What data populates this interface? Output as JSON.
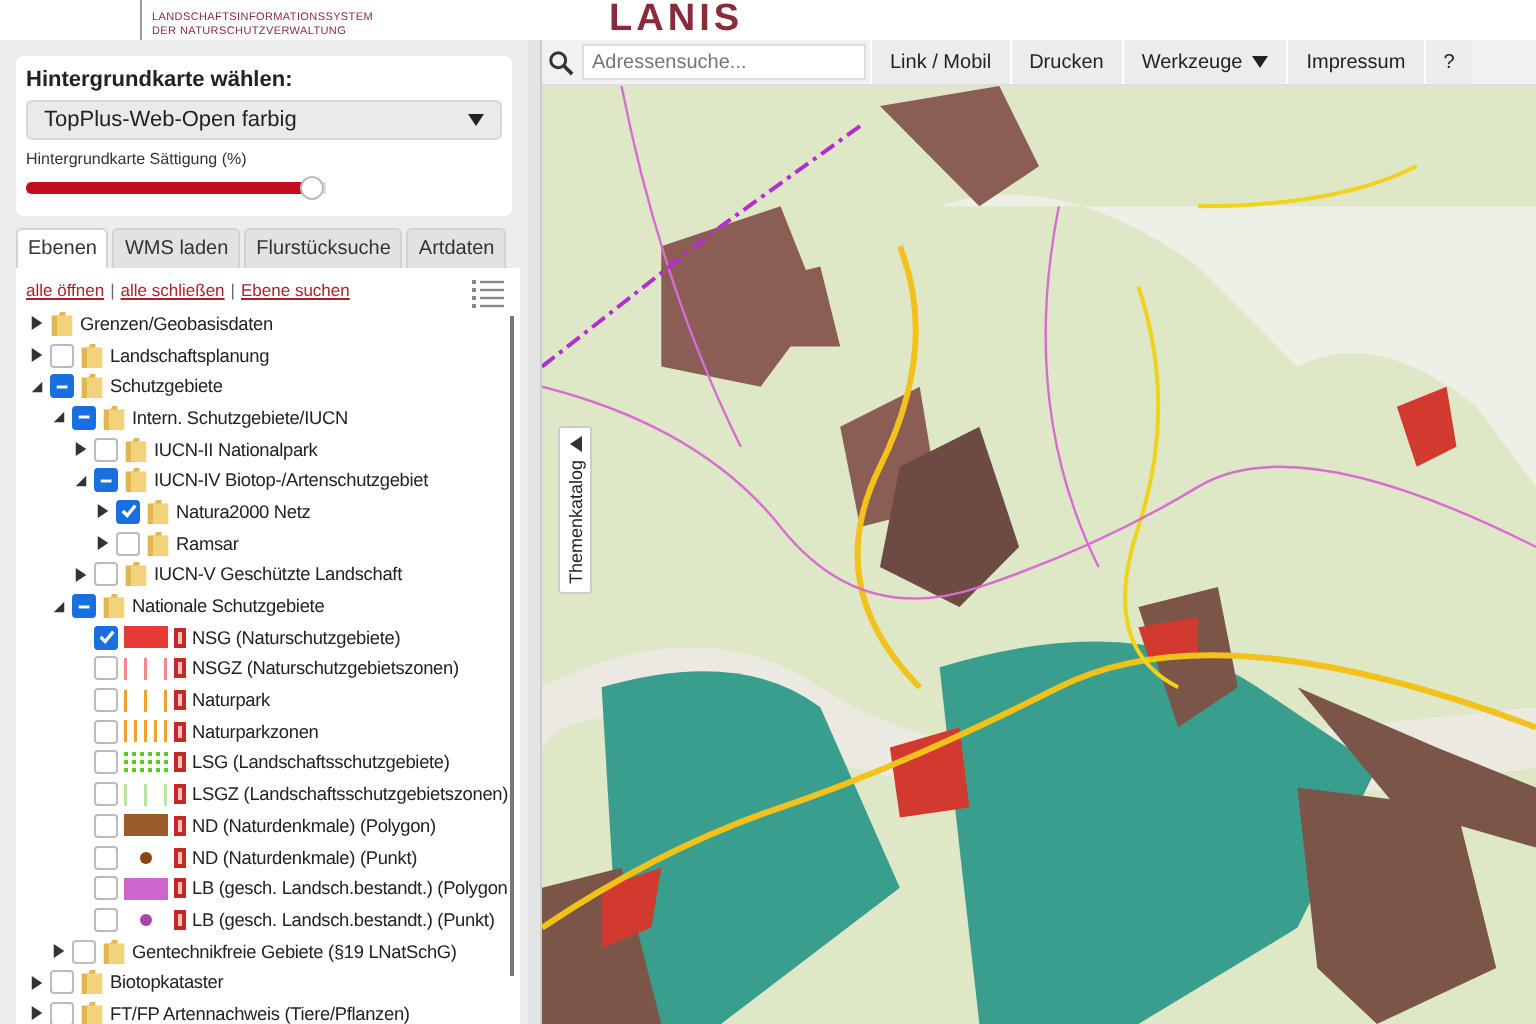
{
  "header": {
    "logo_line1": "LANDSCHAFTSINFORMATIONSSYSTEM",
    "logo_line2": "DER NATURSCHUTZVERWALTUNG",
    "brand": "LANIS"
  },
  "basemap": {
    "title": "Hintergrundkarte wählen:",
    "select_value": "TopPlus-Web-Open farbig",
    "saturation_label": "Hintergrundkarte Sättigung (%)",
    "level": 0.95
  },
  "tabs": [
    {
      "label": "Ebenen",
      "selected": true
    },
    {
      "label": "WMS laden",
      "selected": false
    },
    {
      "label": "Flurstücksuche",
      "selected": false
    },
    {
      "label": "Artdaten",
      "selected": false
    }
  ],
  "tree_links": [
    {
      "kind": "link",
      "text": "alle öffnen"
    },
    {
      "kind": "sep",
      "text": "|"
    },
    {
      "kind": "link",
      "text": "alle schließen"
    },
    {
      "kind": "sep",
      "text": "|"
    },
    {
      "kind": "link",
      "text": "Ebene suchen"
    }
  ],
  "tree": [
    {
      "kind": "folder_nocheck",
      "label": "Grenzen/Geobasisdaten",
      "expanded": false
    },
    {
      "kind": "folder",
      "label": "Landschaftsplanung",
      "checked": false,
      "partial": false,
      "expanded": false
    },
    {
      "kind": "folder",
      "label": "Schutzgebiete",
      "checked": false,
      "partial": true,
      "expanded": true,
      "children": [
        {
          "kind": "folder",
          "label": "Intern. Schutzgebiete/IUCN",
          "checked": false,
          "partial": true,
          "expanded": true,
          "children": [
            {
              "kind": "folder",
              "label": "IUCN-II Nationalpark",
              "checked": false,
              "partial": false,
              "expanded": false
            },
            {
              "kind": "folder",
              "label": "IUCN-IV Biotop-/Artenschutzgebiet",
              "checked": false,
              "partial": true,
              "expanded": true,
              "children": [
                {
                  "kind": "folder",
                  "label": "Natura2000 Netz",
                  "checked": true,
                  "partial": false,
                  "expanded": false
                },
                {
                  "kind": "folder",
                  "label": "Ramsar",
                  "checked": false,
                  "partial": false,
                  "expanded": false
                }
              ]
            },
            {
              "kind": "folder",
              "label": "IUCN-V Geschützte Landschaft",
              "checked": false,
              "partial": false,
              "expanded": false
            }
          ]
        },
        {
          "kind": "folder",
          "label": "Nationale Schutzgebiete",
          "checked": false,
          "partial": true,
          "expanded": true,
          "children": [
            {
              "kind": "fill",
              "label": "NSG (Naturschutzgebiete)",
              "checked": true,
              "color": "#e53935"
            },
            {
              "kind": "sparse_lines",
              "label": "NSGZ (Naturschutzgebietszonen)",
              "checked": false,
              "color": "#f08a8a"
            },
            {
              "kind": "sparse_lines",
              "label": "Naturpark",
              "checked": false,
              "color": "#f0a030"
            },
            {
              "kind": "lines",
              "label": "Naturparkzonen",
              "checked": false,
              "color": "#f0a030"
            },
            {
              "kind": "dots",
              "label": "LSG (Landschaftsschutzgebiete)",
              "checked": false,
              "color": "#55cc22"
            },
            {
              "kind": "sparse_lines",
              "label": "LSGZ (Landschaftsschutzgebietszonen)",
              "checked": false,
              "color": "#b8e6a0"
            },
            {
              "kind": "fill",
              "label": "ND (Naturdenkmale) (Polygon)",
              "checked": false,
              "color": "#9b5a2a"
            },
            {
              "kind": "point",
              "label": "ND (Naturdenkmale) (Punkt)",
              "checked": false,
              "color": "#8b4513"
            },
            {
              "kind": "fill",
              "label": "LB (gesch. Landsch.bestandt.) (Polygon",
              "checked": false,
              "color": "#cc66cc"
            },
            {
              "kind": "point",
              "label": "LB (gesch. Landsch.bestandt.) (Punkt)",
              "checked": false,
              "color": "#aa44aa"
            }
          ]
        },
        {
          "kind": "folder",
          "label": "Gentechnikfreie Gebiete (§19 LNatSchG)",
          "checked": false,
          "partial": false,
          "expanded": false
        }
      ]
    },
    {
      "kind": "folder",
      "label": "Biotopkataster",
      "checked": false,
      "partial": false,
      "expanded": false
    },
    {
      "kind": "folder",
      "label": "FT/FP Artennachweis (Tiere/Pflanzen)",
      "checked": false,
      "partial": false,
      "expanded": false
    }
  ],
  "toolbar": {
    "search_placeholder": "Adressensuche...",
    "buttons": [
      {
        "label": "Link / Mobil",
        "dropdown": false
      },
      {
        "label": "Drucken",
        "dropdown": false
      },
      {
        "label": "Werkzeuge",
        "dropdown": true
      },
      {
        "label": "Impressum",
        "dropdown": false
      },
      {
        "label": "?",
        "dropdown": false
      }
    ]
  },
  "map": {
    "side_tab": "Themenkatalog"
  }
}
